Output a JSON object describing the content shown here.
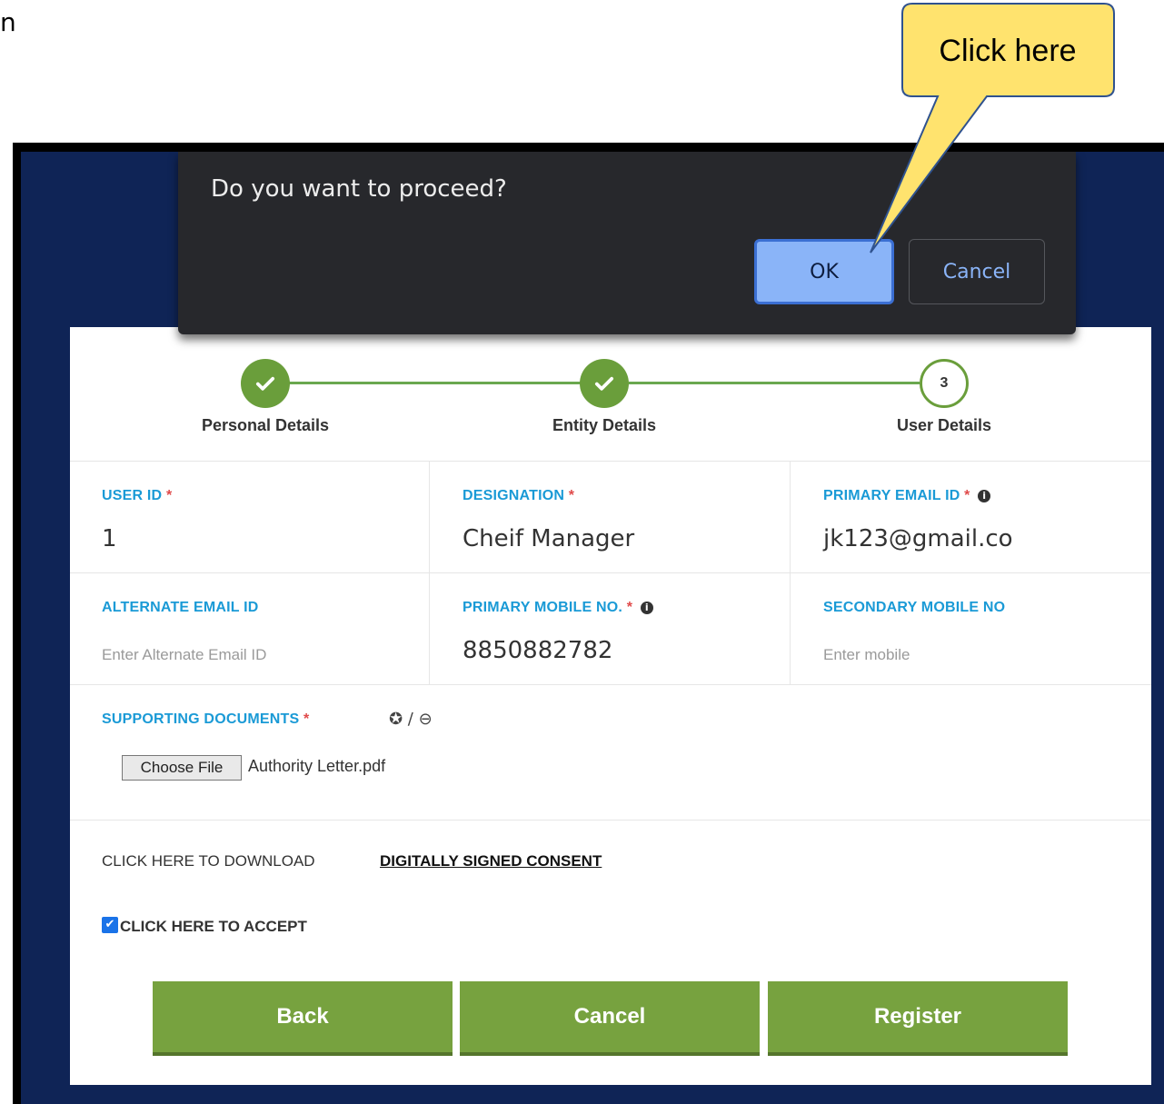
{
  "stray_text": "n",
  "callout": {
    "text": "Click here"
  },
  "dialog": {
    "message": "Do you want to proceed?",
    "ok_label": "OK",
    "cancel_label": "Cancel"
  },
  "stepper": {
    "steps": [
      {
        "label": "Personal Details",
        "status": "done"
      },
      {
        "label": "Entity Details",
        "status": "done"
      },
      {
        "label": "User Details",
        "status": "current",
        "number": "3"
      }
    ]
  },
  "form": {
    "user_id": {
      "label": "USER ID",
      "required": "*",
      "value": "1"
    },
    "designation": {
      "label": "DESIGNATION",
      "required": "*",
      "value": "Cheif Manager"
    },
    "primary_email": {
      "label": "PRIMARY EMAIL ID",
      "required": "*",
      "value": "jk123@gmail.co"
    },
    "alternate_email": {
      "label": "ALTERNATE EMAIL ID",
      "placeholder": "Enter Alternate Email ID"
    },
    "primary_mobile": {
      "label": "PRIMARY MOBILE NO.",
      "required": "*",
      "value": "8850882782"
    },
    "secondary_mobile": {
      "label": "SECONDARY MOBILE NO",
      "placeholder": "Enter mobile"
    },
    "supporting_docs": {
      "label": "SUPPORTING DOCUMENTS",
      "required": "*",
      "add_remove": "✪ / ⊖",
      "choose_file_label": "Choose File",
      "file_name": "Authority Letter.pdf"
    }
  },
  "consent": {
    "download_text": "CLICK HERE TO DOWNLOAD",
    "link_text": "DIGITALLY SIGNED CONSENT",
    "accept_label": "CLICK HERE TO ACCEPT",
    "accept_checked": true
  },
  "actions": {
    "back": "Back",
    "cancel": "Cancel",
    "register": "Register"
  },
  "colors": {
    "navy": "#0f2456",
    "green": "#77a23f",
    "accent_blue": "#1a9ad6",
    "dialog_bg": "#27282c",
    "ok_blue": "#8ab4f8",
    "callout_yellow": "#ffe36e"
  }
}
